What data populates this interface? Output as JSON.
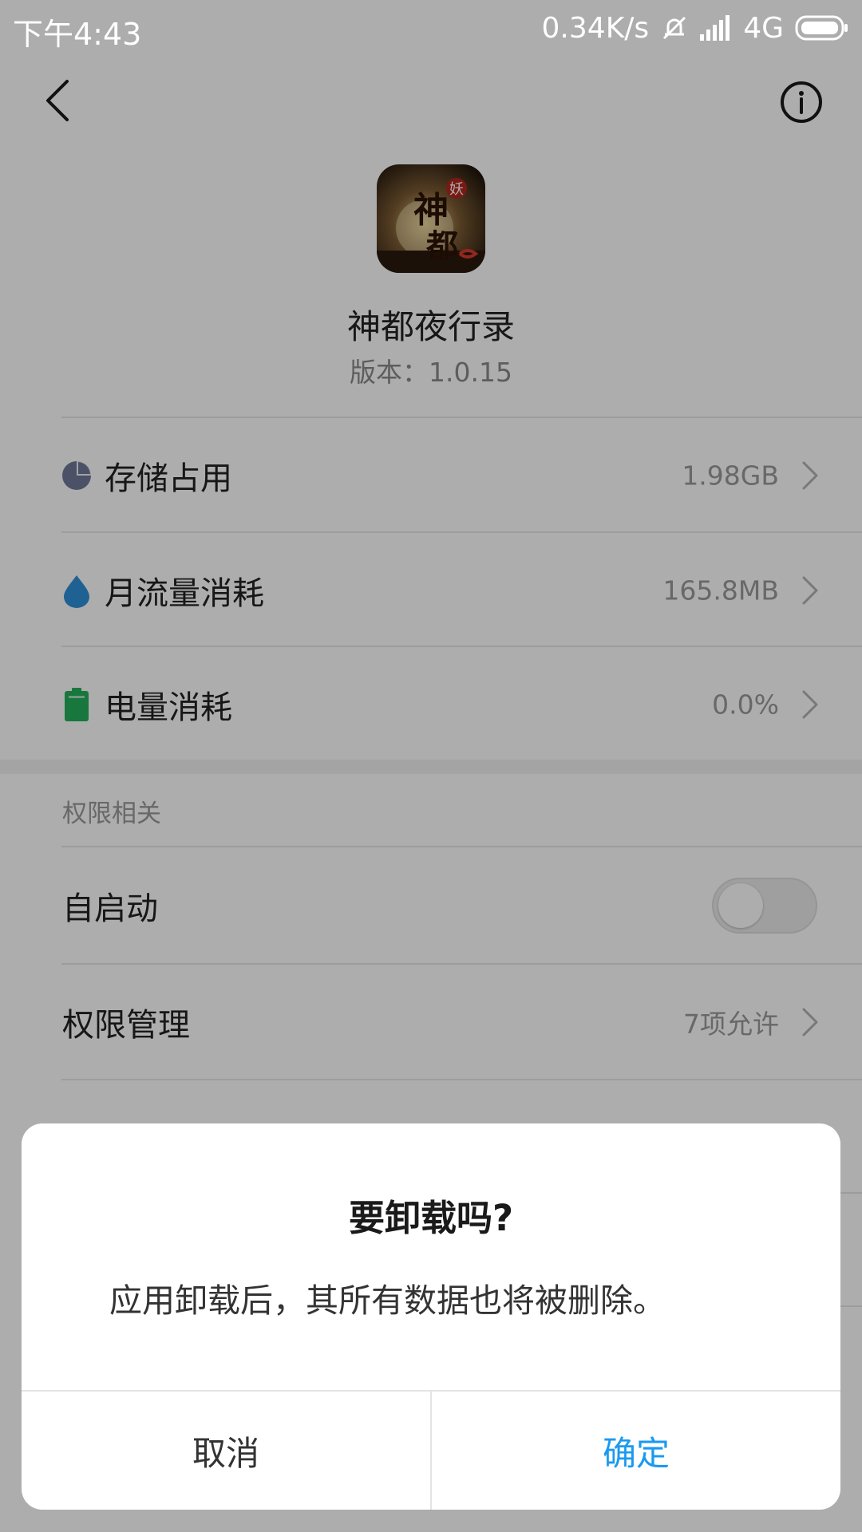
{
  "status_bar": {
    "time": "下午4:43",
    "network_speed": "0.34K/s",
    "network_type": "4G",
    "icons": [
      "mute-icon",
      "signal-icon",
      "battery-icon"
    ]
  },
  "header": {
    "back_icon": "back-chevron-icon",
    "info_icon": "info-icon"
  },
  "app": {
    "name": "神都夜行录",
    "version": "版本：1.0.15",
    "icon_text_main": "神都",
    "icon_text_badge": "妖"
  },
  "stats": [
    {
      "label": "存储占用",
      "value": "1.98GB",
      "icon": "pie-chart-icon",
      "icon_color": "#6f7897"
    },
    {
      "label": "月流量消耗",
      "value": "165.8MB",
      "icon": "water-drop-icon",
      "icon_color": "#2f8fd8"
    },
    {
      "label": "电量消耗",
      "value": "0.0%",
      "icon": "battery-icon",
      "icon_color": "#22b05a"
    }
  ],
  "permissions": {
    "section_title": "权限相关",
    "autostart": {
      "label": "自启动",
      "enabled": false
    },
    "manage": {
      "label": "权限管理",
      "value": "7项允许"
    }
  },
  "dialog": {
    "title": "要卸载吗?",
    "message": "应用卸载后，其所有数据也将被删除。",
    "cancel_label": "取消",
    "confirm_label": "确定",
    "confirm_color": "#1a9af0"
  },
  "colors": {
    "overlay": "#000000",
    "divider": "#e6e6e6"
  }
}
